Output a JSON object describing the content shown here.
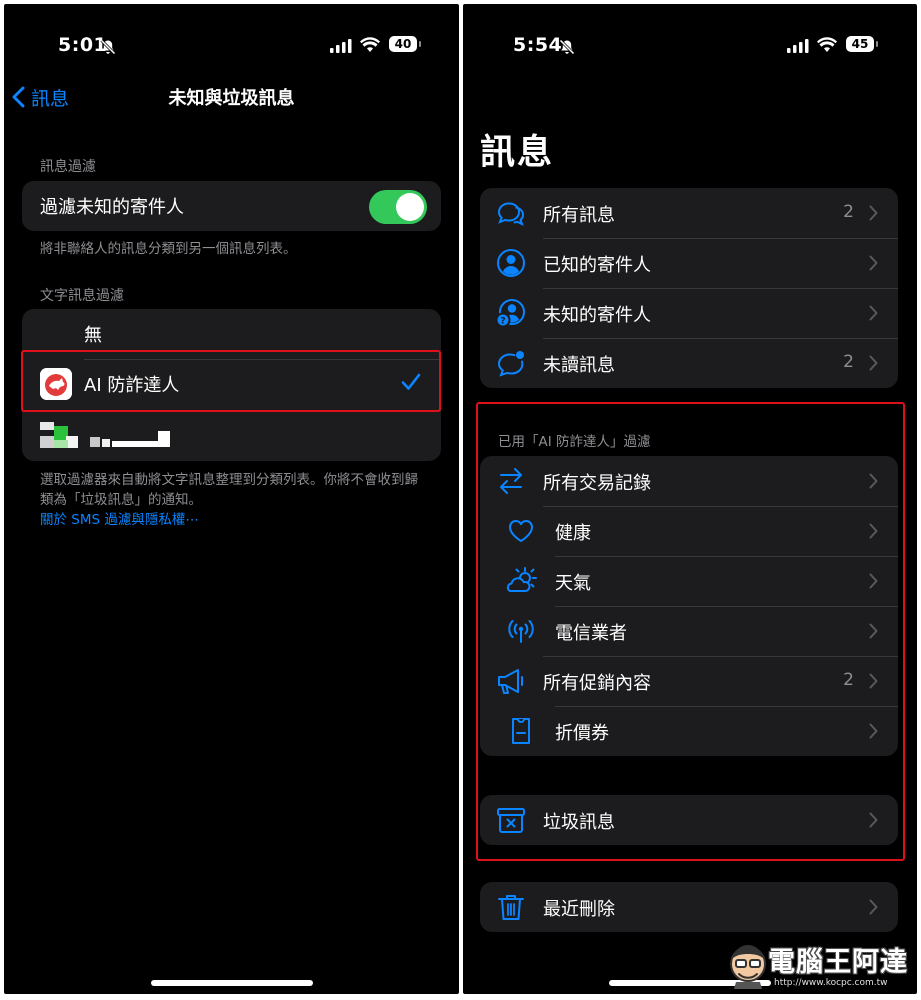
{
  "left_screen": {
    "status": {
      "time": "5:01",
      "battery": "40"
    },
    "nav": {
      "back_label": "訊息",
      "title": "未知與垃圾訊息"
    },
    "message_filter": {
      "header": "訊息過濾",
      "toggle_label": "過濾未知的寄件人",
      "toggle_on": true,
      "footer": "將非聯絡人的訊息分類到另一個訊息列表。"
    },
    "sms_filter": {
      "header": "文字訊息過濾",
      "options": [
        {
          "label": "無",
          "selected": false
        },
        {
          "label": "AI 防詐達人",
          "selected": true
        }
      ],
      "footer": "選取過濾器來自動將文字訊息整理到分類列表。你將不會收到歸類為「垃圾訊息」的通知。",
      "link": "關於 SMS 過濾與隱私權⋯"
    }
  },
  "right_screen": {
    "status": {
      "time": "5:54",
      "battery": "45"
    },
    "title": "訊息",
    "main_list": [
      {
        "icon": "chat-bubbles-icon",
        "label": "所有訊息",
        "count": "2"
      },
      {
        "icon": "person-circle-icon",
        "label": "已知的寄件人",
        "count": ""
      },
      {
        "icon": "person-question-icon",
        "label": "未知的寄件人",
        "count": ""
      },
      {
        "icon": "unread-bubble-icon",
        "label": "未讀訊息",
        "count": "2"
      }
    ],
    "filter_header": "已用「AI 防詐達人」過濾",
    "filter_list": [
      {
        "icon": "arrows-swap-icon",
        "label": "所有交易記錄",
        "count": ""
      },
      {
        "icon": "heart-icon",
        "label": "健康",
        "count": ""
      },
      {
        "icon": "weather-icon",
        "label": "天氣",
        "count": ""
      },
      {
        "icon": "antenna-icon",
        "label": "電信業者",
        "count": ""
      },
      {
        "icon": "megaphone-icon",
        "label": "所有促銷內容",
        "count": "2"
      },
      {
        "icon": "coupon-icon",
        "label": "折價券",
        "count": ""
      }
    ],
    "junk": {
      "icon": "junk-box-icon",
      "label": "垃圾訊息"
    },
    "recently_deleted": {
      "icon": "trash-icon",
      "label": "最近刪除"
    }
  },
  "watermark": {
    "text": "電腦王阿達",
    "url": "http://www.kocpc.com.tw"
  },
  "colors": {
    "accent": "#0a84ff",
    "toggle_on": "#34c759",
    "highlight": "#e0101a",
    "group_bg": "#1c1c1e"
  }
}
